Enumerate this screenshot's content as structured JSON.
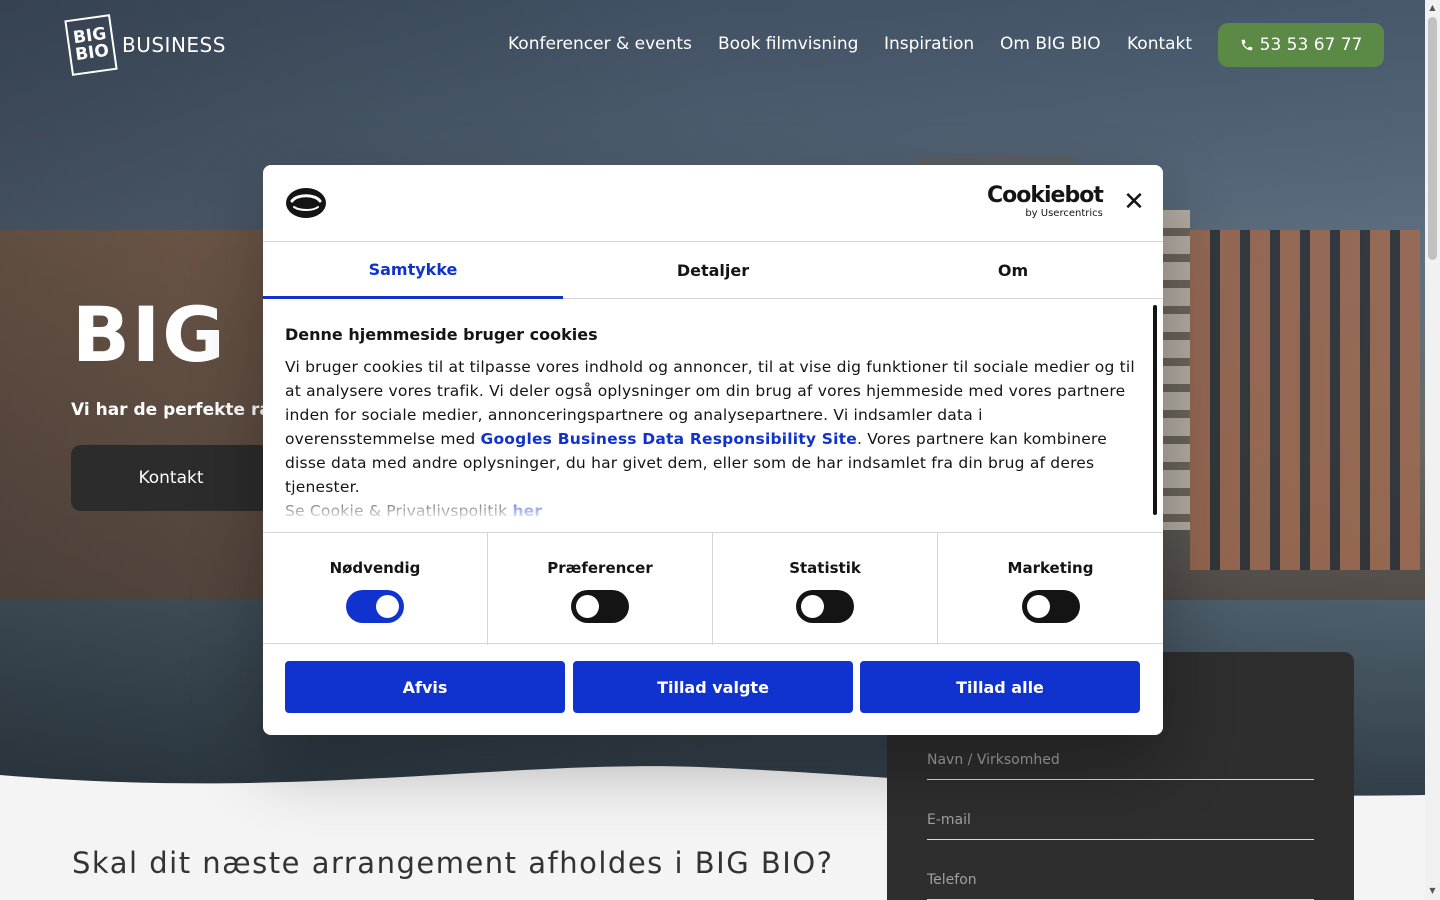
{
  "header": {
    "logo_mark": "BIG BIO",
    "logo_text": "BUSINESS",
    "nav": [
      {
        "label": "Konferencer & events"
      },
      {
        "label": "Book filmvisning"
      },
      {
        "label": "Inspiration"
      },
      {
        "label": "Om BIG BIO"
      },
      {
        "label": "Kontakt"
      }
    ],
    "phone": "53 53 67 77"
  },
  "hero": {
    "title": "BIG",
    "subtitle": "Vi har de perfekte ram",
    "button": "Kontakt"
  },
  "section": {
    "title": "Skal dit næste arrangement afholdes i BIG BIO?"
  },
  "form": {
    "name_placeholder": "Navn / Virksomhed",
    "email_placeholder": "E-mail",
    "phone_placeholder": "Telefon"
  },
  "cookie": {
    "brand": "Cookiebot",
    "brand_sub": "by Usercentrics",
    "tabs": [
      {
        "label": "Samtykke",
        "active": true
      },
      {
        "label": "Detaljer",
        "active": false
      },
      {
        "label": "Om",
        "active": false
      }
    ],
    "body_title": "Denne hjemmeside bruger cookies",
    "body_part1": "Vi bruger cookies til at tilpasse vores indhold og annoncer, til at vise dig funktioner til sociale medier og til at analysere vores trafik. Vi deler også oplysninger om din brug af vores hjemmeside med vores partnere inden for sociale medier, annonceringspartnere og analysepartnere. Vi indsamler data i overensstemmelse med ",
    "body_link": "Googles Business Data Responsibility Site",
    "body_part2": ". Vores partnere kan kombinere disse data med andre oplysninger, du har givet dem, eller som de har indsamlet fra din brug af deres tjenester.",
    "policy_text": "Se Cookie & Privatlivspolitik ",
    "policy_link": "her",
    "toggles": [
      {
        "label": "Nødvendig",
        "on": true
      },
      {
        "label": "Præferencer",
        "on": false
      },
      {
        "label": "Statistik",
        "on": false
      },
      {
        "label": "Marketing",
        "on": false
      }
    ],
    "buttons": {
      "reject": "Afvis",
      "allow_selected": "Tillad valgte",
      "allow_all": "Tillad alle"
    }
  },
  "colors": {
    "accent": "#1032cf",
    "phone_button": "#5a8a45",
    "dark_button": "#2c2c2c"
  }
}
